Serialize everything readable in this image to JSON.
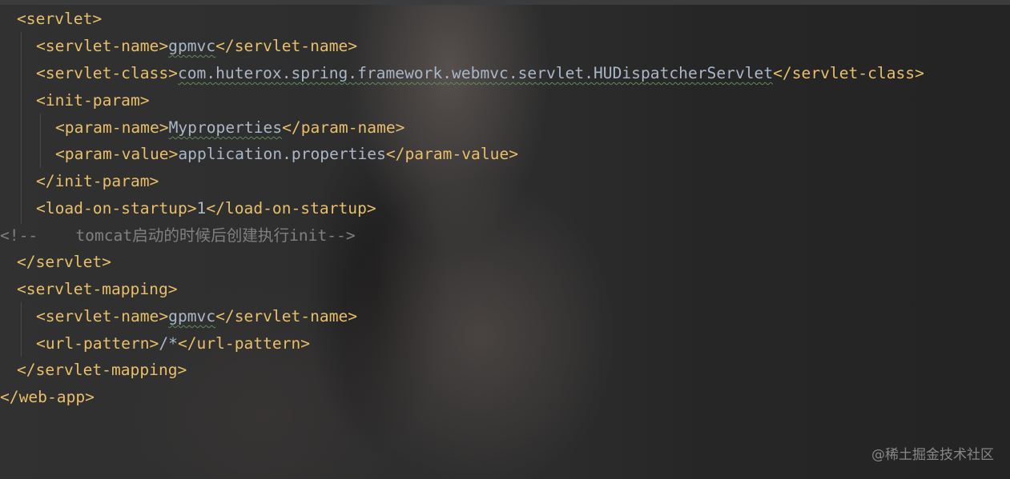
{
  "editor": {
    "lines": [
      {
        "open": "<servlet>",
        "value": "",
        "close": ""
      },
      {
        "open": "<servlet-name>",
        "value": "gpmvc",
        "close": "</servlet-name>"
      },
      {
        "open": "<servlet-class>",
        "value": "com.huterox.spring.framework.webmvc.servlet.HUDispatcherServlet",
        "close": "</servlet-class>"
      },
      {
        "open": "<init-param>",
        "value": "",
        "close": ""
      },
      {
        "open": "<param-name>",
        "value": "Myproperties",
        "close": "</param-name>"
      },
      {
        "open": "<param-value>",
        "value": "application.properties",
        "close": "</param-value>"
      },
      {
        "open": "</init-param>",
        "value": "",
        "close": ""
      },
      {
        "open": "<load-on-startup>",
        "value": "1",
        "close": "</load-on-startup>"
      },
      {
        "comment": "<!--    tomcat启动的时候后创建执行init-->"
      },
      {
        "open": "</servlet>",
        "value": "",
        "close": ""
      },
      {
        "open": "<servlet-mapping>",
        "value": "",
        "close": ""
      },
      {
        "open": "<servlet-name>",
        "value": "gpmvc",
        "close": "</servlet-name>"
      },
      {
        "open": "<url-pattern>",
        "value": "/*",
        "close": "</url-pattern>"
      },
      {
        "open": "</servlet-mapping>",
        "value": "",
        "close": ""
      },
      {
        "open": "</web-app>",
        "value": "",
        "close": ""
      }
    ]
  },
  "watermark": "@稀土掘金技术社区",
  "colors": {
    "background": "#2b2b2b",
    "tag": "#e8bf6a",
    "text": "#a9b7c6",
    "comment": "#808080"
  }
}
